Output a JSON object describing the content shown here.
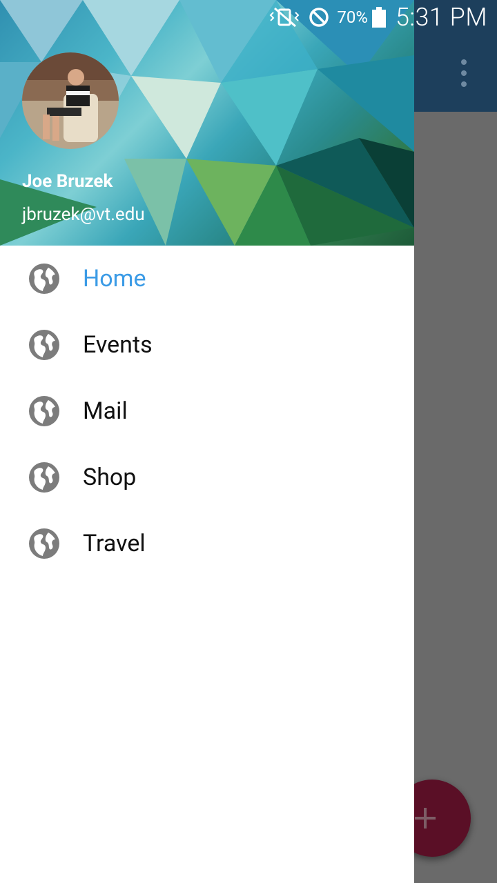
{
  "status_bar": {
    "battery_percent": "70%",
    "time": "5:31 PM",
    "icons": [
      "vibrate-mute-icon",
      "do-not-disturb-icon",
      "battery-icon"
    ]
  },
  "drawer": {
    "user": {
      "name": "Joe Bruzek",
      "email": "jbruzek@vt.edu"
    },
    "items": [
      {
        "label": "Home",
        "icon": "globe-icon",
        "active": true
      },
      {
        "label": "Events",
        "icon": "globe-icon",
        "active": false
      },
      {
        "label": "Mail",
        "icon": "globe-icon",
        "active": false
      },
      {
        "label": "Shop",
        "icon": "globe-icon",
        "active": false
      },
      {
        "label": "Travel",
        "icon": "globe-icon",
        "active": false
      }
    ]
  },
  "app": {
    "toolbar_color": "#1d3f5c",
    "fab_icon": "plus-icon",
    "overflow_icon": "more-vert-icon",
    "accent": "#3b9be6"
  }
}
